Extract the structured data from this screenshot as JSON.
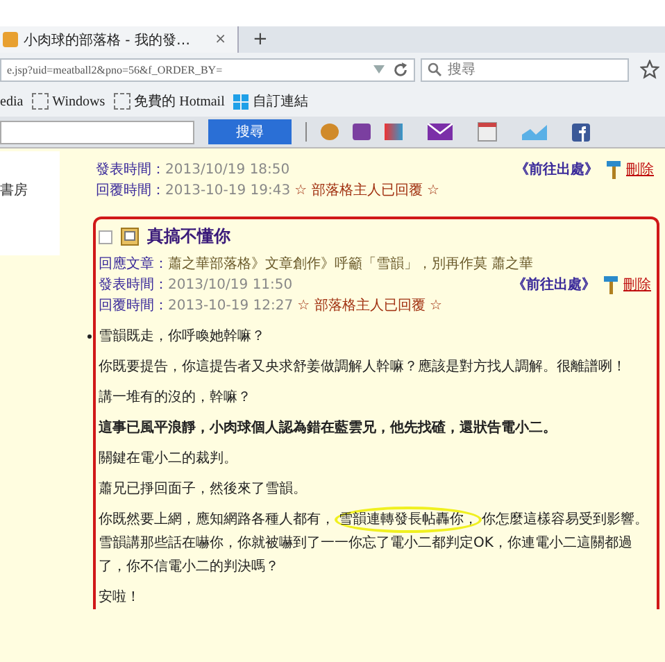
{
  "tab": {
    "title": "小肉球的部落格 - 我的發…",
    "close": "×",
    "new_tab": "+"
  },
  "address": {
    "url": "e.jsp?uid=meatball2&pno=56&f_ORDER_BY=",
    "search_placeholder": "搜尋"
  },
  "bookmarks": [
    {
      "label": "edia",
      "kind": "text"
    },
    {
      "label": "Windows",
      "kind": "folder"
    },
    {
      "label": "免費的 Hotmail",
      "kind": "folder"
    },
    {
      "label": "自訂連結",
      "kind": "windows"
    }
  ],
  "toolbar": {
    "search_button": "搜尋"
  },
  "sidebar": {
    "item": "書房"
  },
  "posts": [
    {
      "highlighted": false,
      "posted_label": "發表時間：",
      "posted": "2013/10/19 18:50",
      "replied_label": "回覆時間：",
      "replied": "2013-10-19 19:43",
      "reply_note": "☆ 部落格主人已回覆 ☆",
      "goto": "《前往出處》",
      "delete": "刪除"
    },
    {
      "highlighted": true,
      "checked": false,
      "title": "真搞不懂你",
      "reply_to_label": "回應文章：",
      "reply_to": "蕭之華部落格》文章創作》呼籲「雪韻」，別再作莫 蕭之華",
      "posted_label": "發表時間：",
      "posted": "2013/10/19 11:50",
      "replied_label": "回覆時間：",
      "replied": "2013-10-19 12:27",
      "reply_note": "☆ 部落格主人已回覆 ☆",
      "goto": "《前往出處》",
      "delete": "刪除",
      "paragraphs": [
        {
          "kind": "bullet",
          "text": "雪韻既走，你呼喚她幹嘛？"
        },
        {
          "kind": "normal",
          "text": "你既要提告，你這提告者又央求舒姜做調解人幹嘛？應該是對方找人調解。很離譜咧！"
        },
        {
          "kind": "normal",
          "text": "講一堆有的沒的，幹嘛？"
        },
        {
          "kind": "bold",
          "text": "這事已風平浪靜，小肉球個人認為錯在藍雲兄，他先找碴，還狀告電小二。"
        },
        {
          "kind": "normal",
          "text": "關鍵在電小二的裁判。"
        },
        {
          "kind": "normal",
          "text": "蕭兄已掙回面子，然後來了雪韻。"
        },
        {
          "kind": "normal",
          "segments": [
            {
              "text": "你既然要上網，應知網路各種人都有，",
              "circled": false
            },
            {
              "text": "雪韻連轉發長帖轟你，",
              "circled": true
            },
            {
              "text": "你怎麼這樣容易受到影響。雪韻講那些話在嚇你，你就被嚇到了一一你忘了電小二都判定OK，你連電小二這關都過了，你不信電小二的判決嗎？",
              "circled": false
            }
          ]
        },
        {
          "kind": "normal",
          "text": "安啦！"
        }
      ]
    }
  ]
}
